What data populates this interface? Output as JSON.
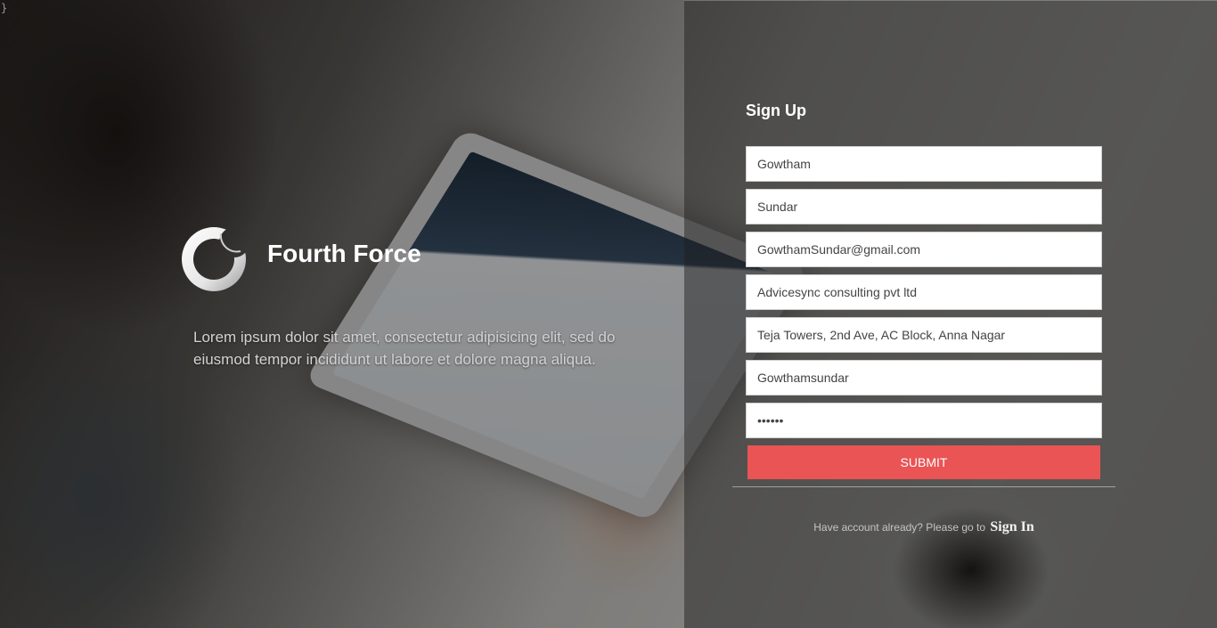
{
  "corner_text": "}",
  "brand": {
    "name": "Fourth Force",
    "tagline": "Lorem ipsum dolor sit amet, consectetur adipisicing elit, sed do eiusmod tempor incididunt ut labore et dolore magna aliqua.",
    "logo_icon": "crescent-ring-icon"
  },
  "form": {
    "title": "Sign Up",
    "fields": [
      {
        "name": "first-name",
        "value": "Gowtham"
      },
      {
        "name": "last-name",
        "value": "Sundar"
      },
      {
        "name": "email",
        "value": "GowthamSundar@gmail.com"
      },
      {
        "name": "company",
        "value": "Advicesync consulting pvt ltd"
      },
      {
        "name": "address",
        "value": "Teja Towers, 2nd Ave, AC Block, Anna Nagar"
      },
      {
        "name": "username",
        "value": "Gowthamsundar"
      },
      {
        "name": "password",
        "value": "••••••"
      }
    ],
    "submit_label": "SUBMIT",
    "signin_prompt": "Have account already? Please go to",
    "signin_link": "Sign In"
  },
  "colors": {
    "accent": "#ea5455",
    "panel_overlay": "#141414"
  }
}
